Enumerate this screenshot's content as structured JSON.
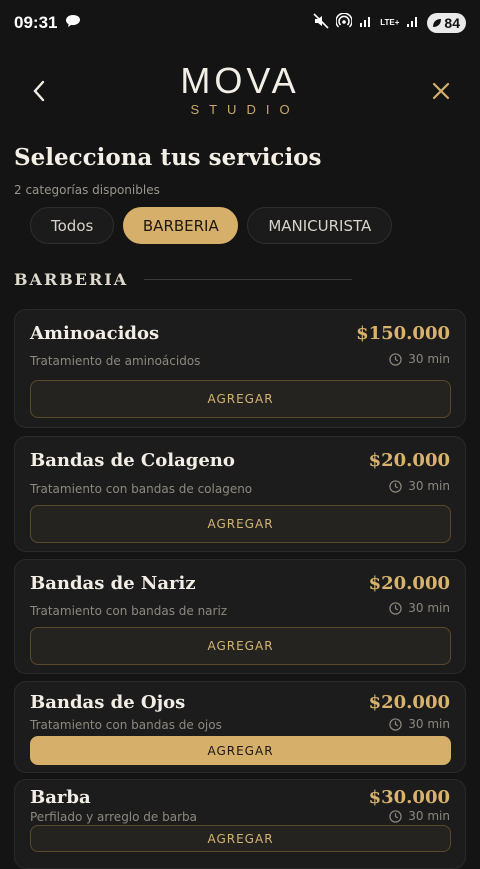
{
  "status_bar": {
    "time": "09:31",
    "battery": "84",
    "network": "LTE+"
  },
  "header": {
    "logo_main": "MOVA",
    "logo_sub": "STUDIO"
  },
  "page": {
    "title": "Selecciona tus servicios",
    "subtitle": "2 categorías disponibles"
  },
  "tabs": [
    {
      "label": "Todos",
      "active": false
    },
    {
      "label": "BARBERIA",
      "active": true
    },
    {
      "label": "MANICURISTA",
      "active": false
    }
  ],
  "section": {
    "title": "BARBERIA"
  },
  "services": [
    {
      "name": "Aminoacidos",
      "description": "Tratamiento de aminoácidos",
      "price": "$150.000",
      "duration": "30 min",
      "button": "AGREGAR"
    },
    {
      "name": "Bandas de Colageno",
      "description": "Tratamiento con bandas de colageno",
      "price": "$20.000",
      "duration": "30 min",
      "button": "AGREGAR"
    },
    {
      "name": "Bandas de Nariz",
      "description": "Tratamiento con bandas de nariz",
      "price": "$20.000",
      "duration": "30 min",
      "button": "AGREGAR"
    },
    {
      "name": "Bandas de Ojos",
      "description": "Tratamiento con bandas de ojos",
      "price": "$20.000",
      "duration": "30 min",
      "button": "AGREGAR"
    },
    {
      "name": "Barba",
      "description": "Perfilado y arreglo de barba",
      "price": "$30.000",
      "duration": "30 min",
      "button": "AGREGAR"
    }
  ],
  "colors": {
    "accent": "#d6b06a",
    "background": "#141414",
    "card": "#1c1c1c"
  }
}
